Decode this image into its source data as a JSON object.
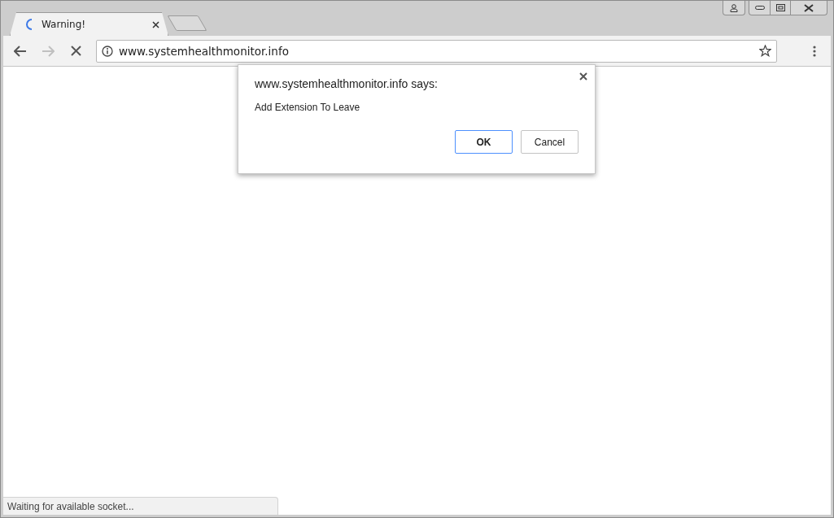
{
  "tabs": [
    {
      "title": "Warning!",
      "selected": true,
      "loading": true
    }
  ],
  "toolbar": {
    "back_disabled": false,
    "forward_disabled": true,
    "loading": true,
    "address": "www.systemhealthmonitor.info",
    "bookmarked": false
  },
  "dialog": {
    "title": "www.systemhealthmonitor.info says:",
    "message": "Add Extension To Leave",
    "buttons": [
      {
        "label": "OK",
        "default": true
      },
      {
        "label": "Cancel",
        "default": false
      }
    ]
  },
  "status_bar": {
    "text": "Waiting for available socket..."
  }
}
